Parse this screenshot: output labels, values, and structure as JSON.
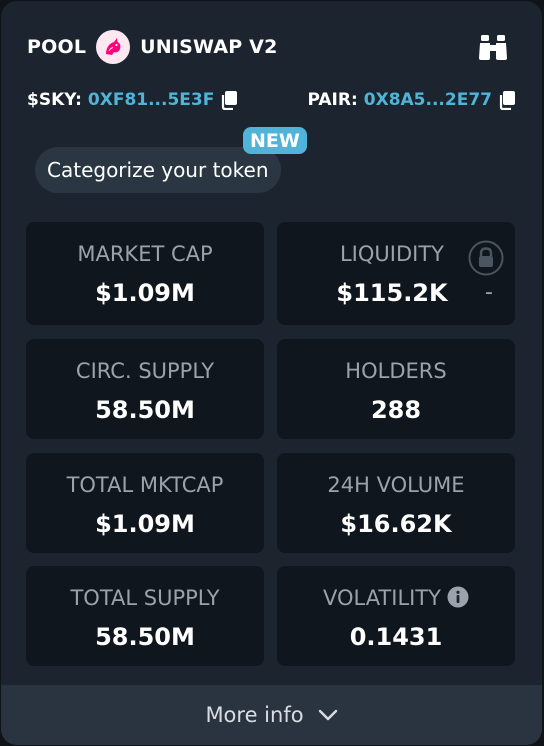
{
  "header": {
    "pool_label": "POOL",
    "dex_name": "UNISWAP V2",
    "dex_logo_icon": "uniswap-unicorn-icon",
    "watch_icon": "binoculars-icon"
  },
  "addresses": {
    "token_label": "$SKY:",
    "token_address": "0XF81...5E3F",
    "pair_label": "PAIR:",
    "pair_address": "0X8A5...2E77",
    "copy_icon": "copy-icon"
  },
  "categorize": {
    "label": "Categorize your token",
    "badge": "NEW"
  },
  "stats": [
    {
      "label": "MARKET CAP",
      "value": "$1.09M"
    },
    {
      "label": "LIQUIDITY",
      "value": "$115.2K",
      "extra": "-",
      "icon": "lock-icon"
    },
    {
      "label": "CIRC. SUPPLY",
      "value": "58.50M"
    },
    {
      "label": "HOLDERS",
      "value": "288"
    },
    {
      "label": "TOTAL MKTCAP",
      "value": "$1.09M"
    },
    {
      "label": "24H VOLUME",
      "value": "$16.62K"
    },
    {
      "label": "TOTAL SUPPLY",
      "value": "58.50M"
    },
    {
      "label": "VOLATILITY",
      "value": "0.1431",
      "icon": "info-icon"
    }
  ],
  "footer": {
    "more_info": "More info",
    "icon": "chevron-down-icon"
  },
  "colors": {
    "accent": "#4fb4d8",
    "card_bg": "#1c252f",
    "tile_bg": "#0f161d"
  }
}
